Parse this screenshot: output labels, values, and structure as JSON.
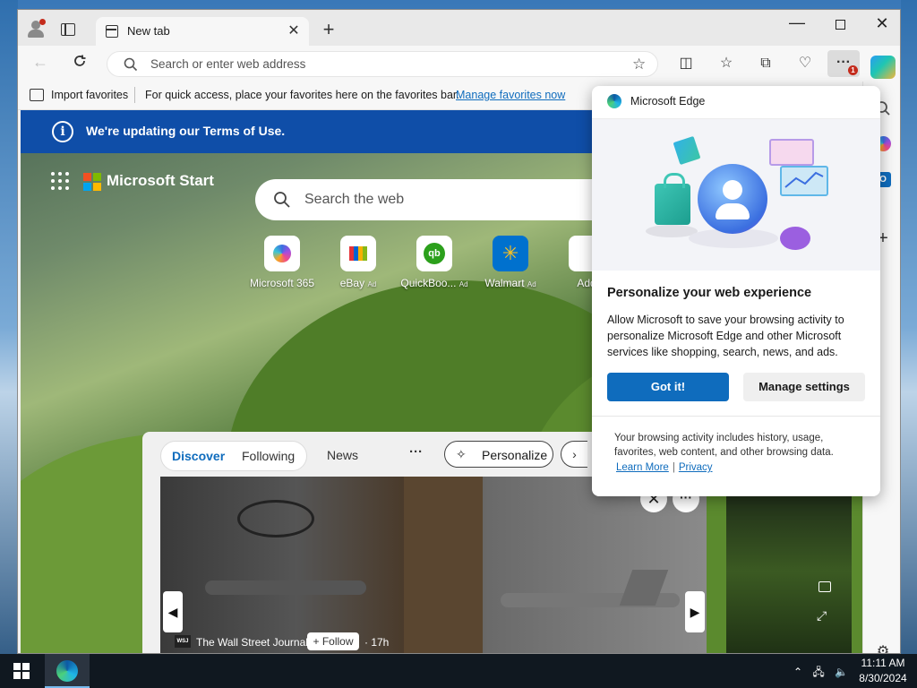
{
  "browser": {
    "tab_title": "New tab",
    "address_placeholder": "Search or enter web address",
    "notification_count": "1"
  },
  "favorites_bar": {
    "import_label": "Import favorites",
    "hint_text": "For quick access, place your favorites here on the favorites bar.",
    "manage_link": "Manage favorites now"
  },
  "page": {
    "terms_banner": "We're updating our Terms of Use.",
    "brand": "Microsoft Start",
    "search_placeholder": "Search the web",
    "quick_links": [
      {
        "label": "Microsoft 365",
        "ad": ""
      },
      {
        "label": "eBay",
        "ad": "Ad"
      },
      {
        "label": "QuickBoo...",
        "ad": "Ad"
      },
      {
        "label": "Walmart",
        "ad": "Ad"
      },
      {
        "label": "Add",
        "ad": ""
      }
    ],
    "feed": {
      "tabs": [
        "Discover",
        "Following"
      ],
      "news_label": "News",
      "personalize_label": "Personalize",
      "hero": {
        "source_logo": "WSJ",
        "source": "The Wall Street Journal",
        "follow_label": "+ Follow",
        "time": "· 17h"
      }
    }
  },
  "popup": {
    "header": "Microsoft Edge",
    "heading": "Personalize your web experience",
    "body": "Allow Microsoft to save your browsing activity to personalize Microsoft Edge and other Microsoft services like shopping, search, news, and ads.",
    "primary_button": "Got it!",
    "secondary_button": "Manage settings",
    "footer": "Your browsing activity includes history, usage, favorites, web content, and other browsing data.",
    "learn_more": "Learn More",
    "privacy": "Privacy"
  },
  "taskbar": {
    "time": "11:11 AM",
    "date": "8/30/2024"
  },
  "icons": {
    "browser_toolbar": [
      "split-screen-icon",
      "favorites-icon",
      "collections-icon",
      "browser-essentials-icon",
      "more-icon"
    ],
    "sidebar": [
      "copilot-icon",
      "search-icon",
      "m365-icon",
      "outlook-icon",
      "add-icon",
      "settings-icon"
    ]
  },
  "colors": {
    "accent": "#0f6cbd",
    "terms_banner_bg": "#0f4ea8",
    "badge": "#c42b1c"
  }
}
